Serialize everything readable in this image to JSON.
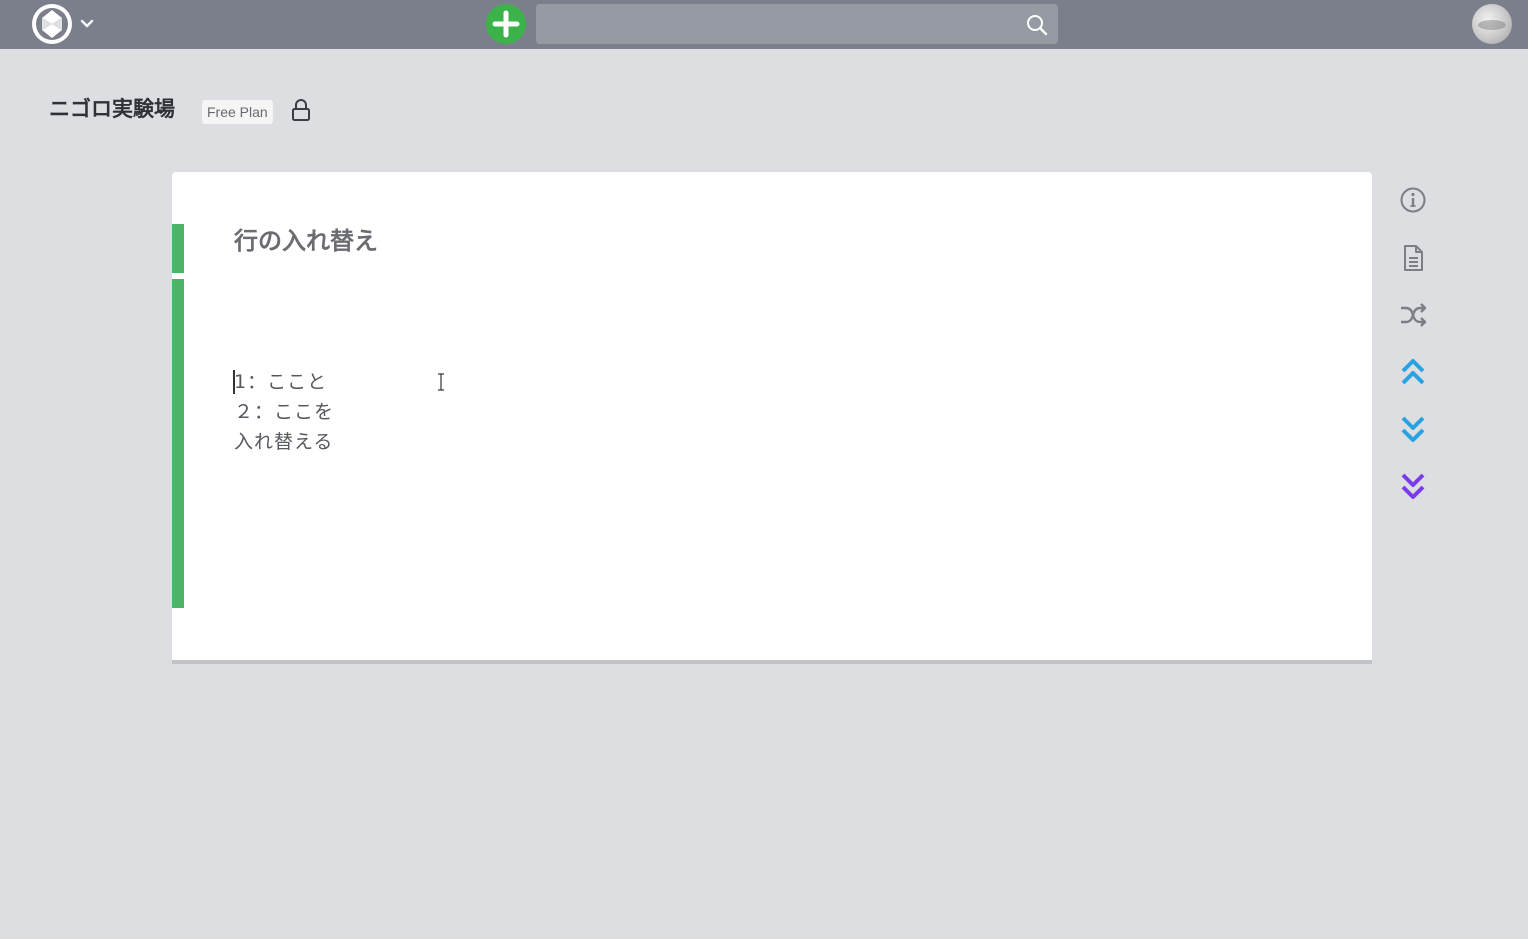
{
  "project": {
    "name": "ニゴロ実験場",
    "plan_badge": "Free Plan"
  },
  "page": {
    "title": "行の入れ替え",
    "lines": [
      "1：ここと",
      "２：ここを",
      "入れ替える"
    ]
  },
  "search": {
    "value": "",
    "placeholder": ""
  },
  "icons": {
    "logo": "logo-icon",
    "menu": "chevron-down-icon",
    "new_page": "plus-icon",
    "search": "search-icon",
    "user": "avatar",
    "privacy": "lock-icon",
    "tools": [
      "info-icon",
      "document-icon",
      "shuffle-icon",
      "chevron-double-up-icon",
      "chevron-double-down-icon",
      "chevron-double-down-bottom-icon"
    ]
  },
  "colors": {
    "navbar": "#7b7f8b",
    "add_button": "#3cb34a",
    "page_bar": "#4cb466",
    "move_up": "#29a3e0",
    "move_down": "#29a3e0",
    "move_bottom": "#7c3aed",
    "tool_gray": "#7b7f85"
  }
}
